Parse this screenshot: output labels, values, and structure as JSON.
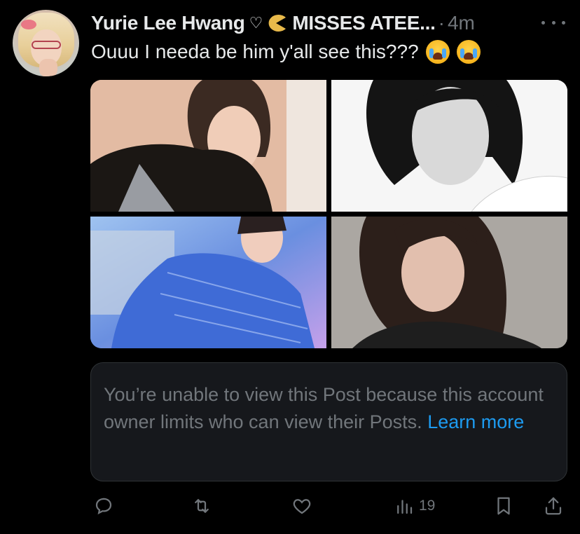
{
  "post": {
    "display_name": "Yurie Lee Hwang",
    "heart_symbol": "♡",
    "display_name_suffix": "MISSES ATEE...",
    "separator": "·",
    "time": "4m",
    "text": "Ouuu I needa be him y'all see this???",
    "emojis": [
      "loudly-crying-face",
      "loudly-crying-face"
    ]
  },
  "restricted_notice": {
    "message": "You’re unable to view this Post because this account owner limits who can view their Posts.",
    "link_label": "Learn more"
  },
  "actions": {
    "reply_icon": "reply-icon",
    "repost_icon": "repost-icon",
    "like_icon": "heart-icon",
    "views_icon": "views-chart-icon",
    "views_count": "19",
    "bookmark_icon": "bookmark-icon",
    "share_icon": "share-icon"
  },
  "colors": {
    "background": "#000000",
    "text_primary": "#e7e9ea",
    "text_secondary": "#71767b",
    "link": "#1d9bf0",
    "card_bg": "#16181c",
    "border": "#2f3336"
  }
}
